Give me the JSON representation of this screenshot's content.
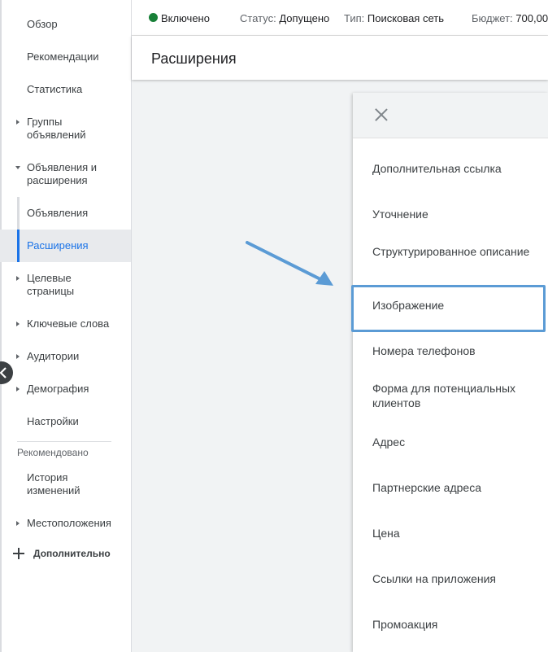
{
  "topbar": {
    "enabled": "Включено",
    "status_label": "Статус:",
    "status_value": "Допущено",
    "type_label": "Тип:",
    "type_value": "Поисковая сеть",
    "budget_label": "Бюджет:",
    "budget_value": "700,00"
  },
  "page": {
    "title": "Расширения"
  },
  "sidebar": {
    "items": [
      {
        "label": "Обзор"
      },
      {
        "label": "Рекомендации"
      },
      {
        "label": "Статистика"
      },
      {
        "label": "Группы объявлений"
      },
      {
        "label": "Объявления и расширения"
      },
      {
        "label": "Объявления"
      },
      {
        "label": "Расширения"
      },
      {
        "label": "Целевые страницы"
      },
      {
        "label": "Ключевые слова"
      },
      {
        "label": "Аудитории"
      },
      {
        "label": "Демография"
      },
      {
        "label": "Настройки"
      },
      {
        "label": "История изменений"
      },
      {
        "label": "Местоположения"
      }
    ],
    "section_label": "Рекомендовано",
    "more_label": "Дополнительно"
  },
  "dropdown": {
    "options": [
      {
        "label": "Дополнительная ссылка"
      },
      {
        "label": "Уточнение"
      },
      {
        "label": "Структурированное описание"
      },
      {
        "label": "Изображение"
      },
      {
        "label": "Номера телефонов"
      },
      {
        "label": "Форма для потенциальных клиентов"
      },
      {
        "label": "Адрес"
      },
      {
        "label": "Партнерские адреса"
      },
      {
        "label": "Цена"
      },
      {
        "label": "Ссылки на приложения"
      },
      {
        "label": "Промоакция"
      }
    ],
    "highlighted": "Изображение"
  },
  "colors": {
    "accent": "#1a73e8",
    "status_dot": "#188038",
    "highlight_border": "#5b9bd5"
  }
}
